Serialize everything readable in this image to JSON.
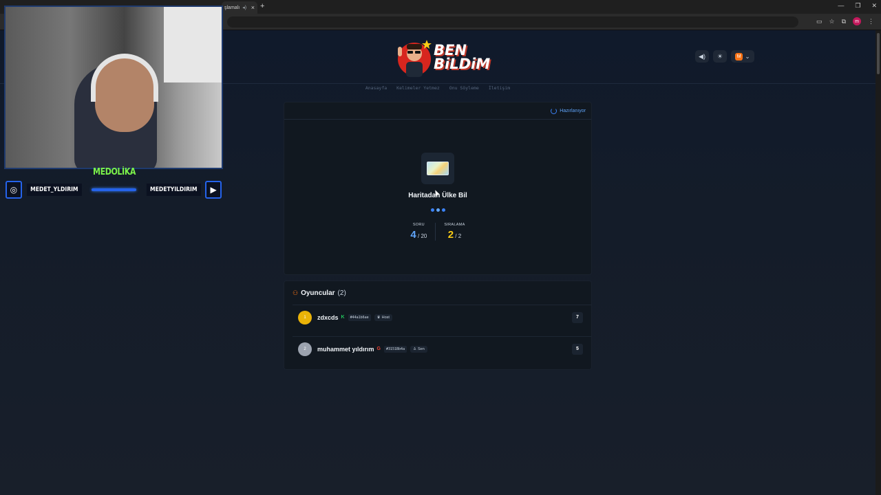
{
  "browser": {
    "tab_title": "şlamalı",
    "new_tab": "+",
    "window_controls": [
      "—",
      "❐",
      "✕"
    ],
    "profile_initial": "m"
  },
  "header": {
    "logo_line1": "BEN",
    "logo_line2": "BiLDiM",
    "nav": [
      "Anasayfa",
      "Kelimeler Yetmez",
      "Onu Söyleme",
      "İletişim"
    ],
    "user_initial": "M"
  },
  "game": {
    "status": "Hazırlanıyor",
    "title": "Haritadan Ülke Bil",
    "soru_label": "SORU",
    "soru_value": "4",
    "soru_total": "/ 20",
    "siralama_label": "SIRALAMA",
    "siralama_value": "2",
    "siralama_total": "/ 2"
  },
  "players": {
    "heading": "Oyuncular",
    "count": "(2)",
    "rows": [
      {
        "rank": "1",
        "name": "zdxcds",
        "provider": "K",
        "id": "#44a1b6ae",
        "tag": "Host",
        "score": "7"
      },
      {
        "rank": "2",
        "name": "muhammet yıldırım",
        "provider": "G",
        "id": "#3151Bb4a",
        "tag": "Sen",
        "score": "5"
      }
    ]
  },
  "stream_overlay": {
    "streamer_name": "MEDOLİKA",
    "instagram": "MEDET_YLDIRIM",
    "youtube": "MEDETYILDIRIM"
  },
  "colors": {
    "accent_blue": "#60a5fa",
    "accent_yellow": "#facc15",
    "accent_orange": "#f97316",
    "kick_green": "#22c55e"
  }
}
